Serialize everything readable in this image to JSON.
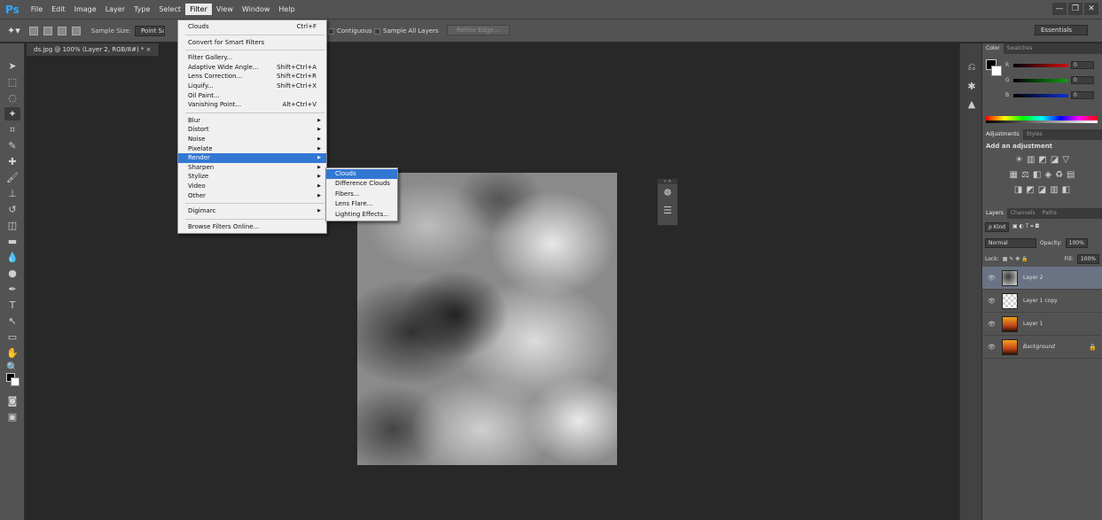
{
  "app": {
    "logo": "Ps"
  },
  "menubar": {
    "items": [
      "File",
      "Edit",
      "Image",
      "Layer",
      "Type",
      "Select",
      "Filter",
      "View",
      "Window",
      "Help"
    ],
    "active": "Filter"
  },
  "window_controls": {
    "minimize": "—",
    "maximize": "❐",
    "close": "✕"
  },
  "options_bar": {
    "sample_size_label": "Sample Size:",
    "sample_size_value": "Point Sample",
    "contiguous_label": "Contiguous",
    "sample_all_layers_label": "Sample All Layers",
    "refine_edge_label": "Refine Edge...",
    "workspace": "Essentials"
  },
  "document": {
    "tab_title": "ds.jpg @ 100% (Layer 2, RGB/8#) * ×"
  },
  "filter_menu": {
    "last_filter": {
      "label": "Clouds",
      "shortcut": "Ctrl+F"
    },
    "convert_smart": "Convert for Smart Filters",
    "group1": [
      {
        "label": "Filter Gallery...",
        "shortcut": ""
      },
      {
        "label": "Adaptive Wide Angle...",
        "shortcut": "Shift+Ctrl+A"
      },
      {
        "label": "Lens Correction...",
        "shortcut": "Shift+Ctrl+R"
      },
      {
        "label": "Liquify...",
        "shortcut": "Shift+Ctrl+X"
      },
      {
        "label": "Oil Paint...",
        "shortcut": ""
      },
      {
        "label": "Vanishing Point...",
        "shortcut": "Alt+Ctrl+V"
      }
    ],
    "group2": [
      "Blur",
      "Distort",
      "Noise",
      "Pixelate",
      "Render",
      "Sharpen",
      "Stylize",
      "Video",
      "Other"
    ],
    "highlighted": "Render",
    "group3": [
      "Digimarc"
    ],
    "browse_online": "Browse Filters Online..."
  },
  "render_submenu": {
    "items": [
      "Clouds",
      "Difference Clouds",
      "Fibers...",
      "Lens Flare...",
      "Lighting Effects..."
    ],
    "highlighted": "Clouds"
  },
  "color_panel": {
    "tabs": [
      "Color",
      "Swatches"
    ],
    "channels": [
      {
        "label": "R",
        "value": "0",
        "color": "#d01010"
      },
      {
        "label": "G",
        "value": "0",
        "color": "#10a010"
      },
      {
        "label": "B",
        "value": "0",
        "color": "#1030d0"
      }
    ]
  },
  "adjustments_panel": {
    "tabs": [
      "Adjustments",
      "Styles"
    ],
    "title": "Add an adjustment",
    "icon_rows": [
      [
        "☀",
        "▥",
        "◩",
        "◪",
        "▽"
      ],
      [
        "▦",
        "⚖",
        "◧",
        "◈",
        "♻",
        "▤"
      ],
      [
        "◨",
        "◩",
        "◪",
        "▥",
        "◧"
      ]
    ]
  },
  "layers_panel": {
    "tabs": [
      "Layers",
      "Channels",
      "Paths"
    ],
    "kind_filter": "ρ Kind",
    "blend_mode": "Normal",
    "opacity_label": "Opacity:",
    "opacity_value": "100%",
    "lock_label": "Lock:",
    "fill_label": "Fill:",
    "fill_value": "100%",
    "layers": [
      {
        "name": "Layer 2",
        "thumb": "clouds",
        "selected": true,
        "locked": false,
        "italic": false
      },
      {
        "name": "Layer 1 copy",
        "thumb": "check",
        "selected": false,
        "locked": false,
        "italic": false
      },
      {
        "name": "Layer 1",
        "thumb": "sunset",
        "selected": false,
        "locked": false,
        "italic": false
      },
      {
        "name": "Background",
        "thumb": "sunset",
        "selected": false,
        "locked": true,
        "italic": true
      }
    ]
  },
  "colors": {
    "menu_highlight": "#3278d3",
    "panel_bg": "#535353",
    "canvas_bg": "#282828",
    "selected_layer": "#6a7383"
  }
}
